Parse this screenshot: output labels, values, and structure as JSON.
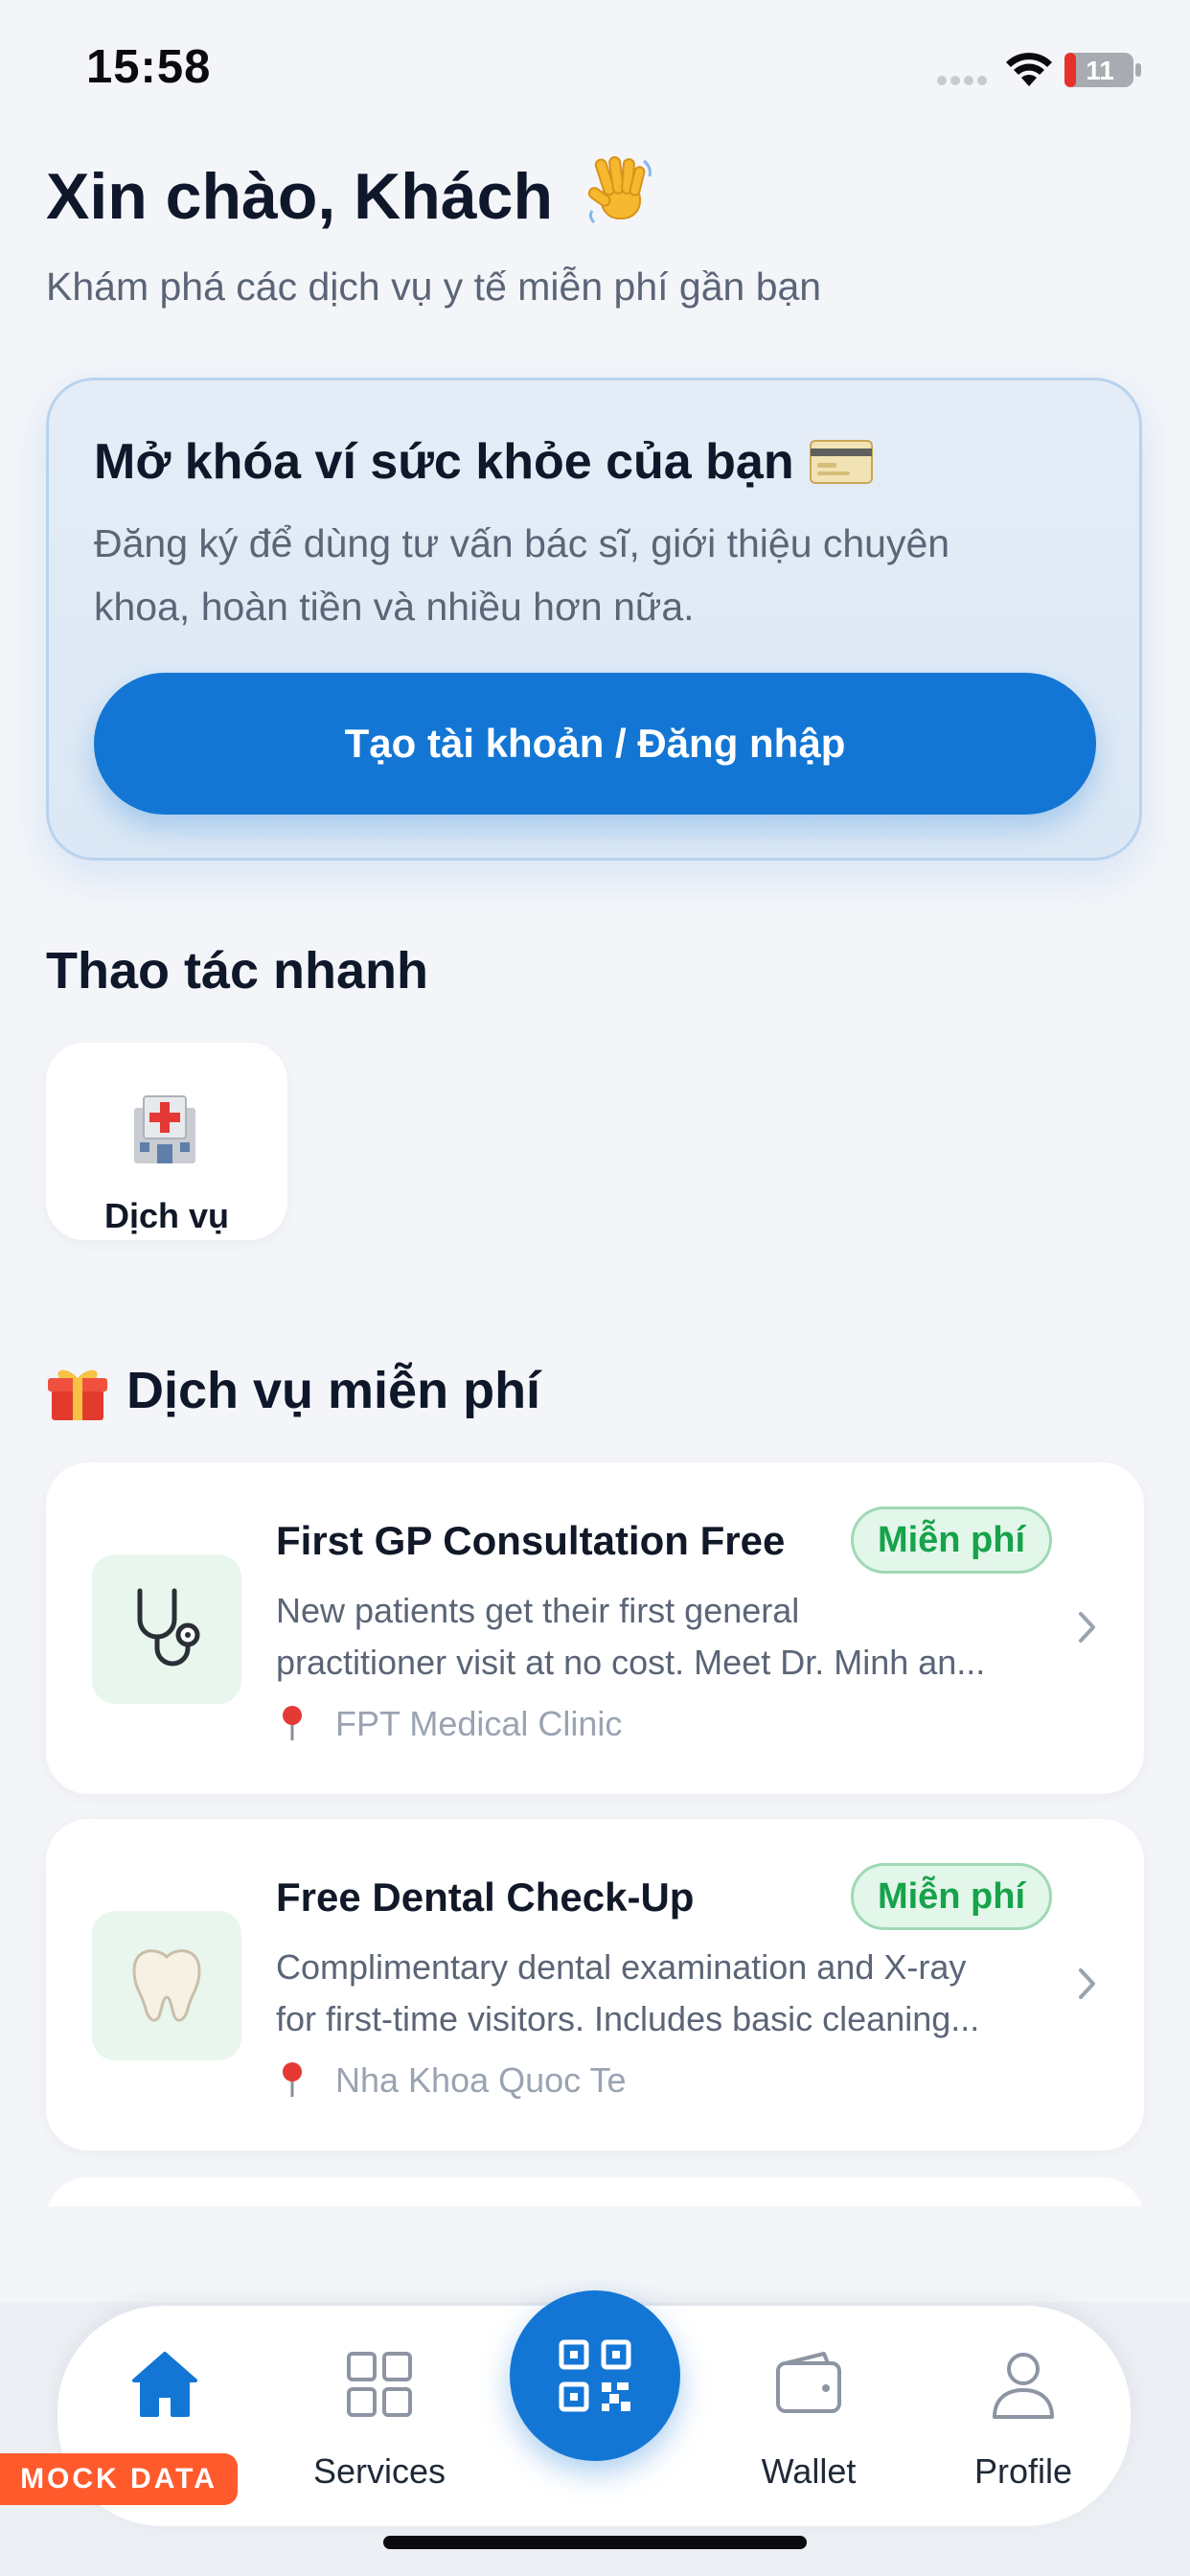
{
  "status_bar": {
    "time": "15:58",
    "battery_level": "11"
  },
  "header": {
    "greeting": "Xin chào, Khách",
    "greeting_emoji": "waving-hand-icon",
    "subtitle": "Khám phá các dịch vụ y tế miễn phí gần bạn"
  },
  "wallet_card": {
    "title": "Mở khóa ví sức khỏe của bạn",
    "title_icon": "credit-card-icon",
    "description": "Đăng ký để dùng tư vấn bác sĩ, giới thiệu chuyên khoa, hoàn tiền và nhiều hơn nữa.",
    "cta_label": "Tạo tài khoản / Đăng nhập"
  },
  "quick_actions": {
    "title": "Thao tác nhanh",
    "items": [
      {
        "label": "Dịch vụ",
        "icon": "hospital-icon"
      }
    ]
  },
  "free_services": {
    "title": "Dịch vụ miễn phí",
    "title_icon": "gift-icon",
    "items": [
      {
        "name": "First GP Consultation Free",
        "badge": "Miễn phí",
        "desc_line1": "New patients get their first general",
        "desc_line2": "practitioner visit at no cost. Meet Dr. Minh an...",
        "location": "FPT Medical Clinic",
        "icon": "stethoscope-icon"
      },
      {
        "name": "Free Dental Check-Up",
        "badge": "Miễn phí",
        "desc_line1": "Complimentary dental examination and X-ray",
        "desc_line2": "for first-time visitors. Includes basic cleaning...",
        "location": "Nha Khoa Quoc Te",
        "icon": "tooth-icon"
      }
    ]
  },
  "bottom_nav": {
    "items": [
      {
        "label": "",
        "icon": "home-icon",
        "active": true
      },
      {
        "label": "Services",
        "icon": "grid-icon",
        "active": false
      },
      {
        "label": "",
        "icon": "qr-code-icon",
        "active": false
      },
      {
        "label": "Wallet",
        "icon": "wallet-icon",
        "active": false
      },
      {
        "label": "Profile",
        "icon": "person-icon",
        "active": false
      }
    ],
    "mock_badge": "MOCK DATA"
  },
  "colors": {
    "accent": "#1376d4",
    "badge_green": "#16a34a",
    "background": "#f3f5f9",
    "mock_badge": "#ff5a2c"
  }
}
